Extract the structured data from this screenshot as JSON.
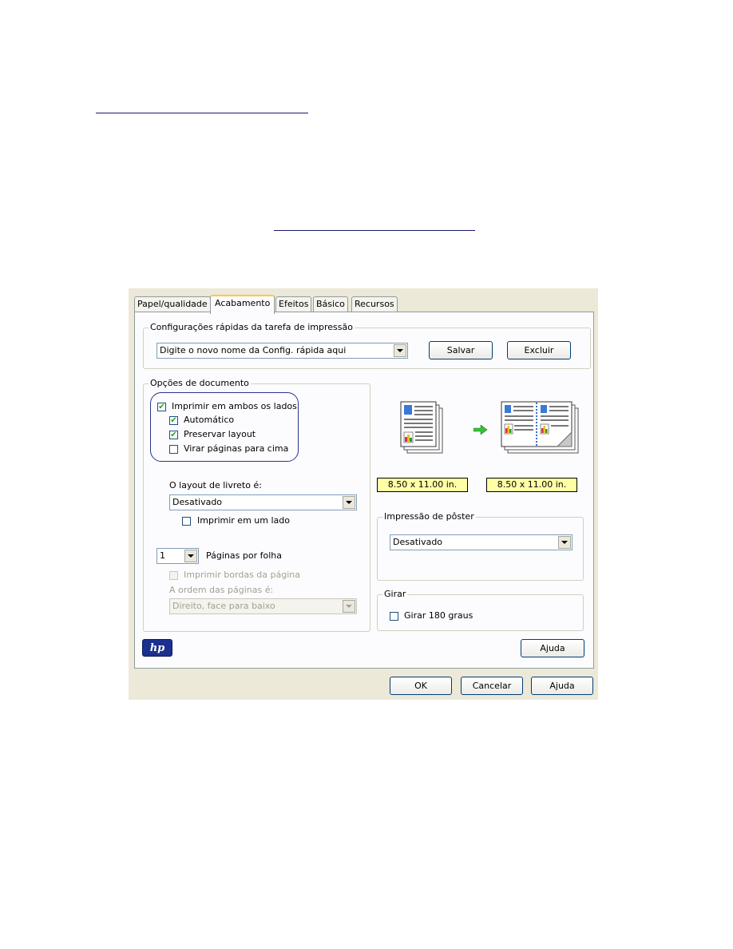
{
  "dialog": {
    "tabs": [
      "Papel/qualidade",
      "Acabamento",
      "Efeitos",
      "Básico",
      "Recursos"
    ],
    "active_tab": "Acabamento",
    "quick_settings": {
      "group_label": "Configurações rápidas da tarefa de impressão",
      "combo_value": "Digite o novo nome da Config. rápida aqui",
      "save_label": "Salvar",
      "delete_label": "Excluir"
    },
    "document_options": {
      "group_label": "Opções de documento",
      "print_both_sides": {
        "label": "Imprimir em ambos os lados",
        "checked": true
      },
      "automatic": {
        "label": "Automático",
        "checked": true
      },
      "preserve_layout": {
        "label": "Preservar layout",
        "checked": true
      },
      "flip_pages_up": {
        "label": "Virar páginas para cima",
        "checked": false
      },
      "booklet_label": "O layout de livreto é:",
      "booklet_value": "Desativado",
      "print_one_side": {
        "label": "Imprimir em um lado",
        "checked": false
      },
      "pages_per_sheet_value": "1",
      "pages_per_sheet_label": "Páginas por folha",
      "print_borders": {
        "label": "Imprimir bordas da página",
        "checked": false
      },
      "page_order_label": "A ordem das páginas é:",
      "page_order_value": "Direito, face para baixo"
    },
    "preview": {
      "left_size": "8.50 x 11.00 in.",
      "right_size": "8.50 x 11.00 in."
    },
    "poster": {
      "group_label": "Impressão de pôster",
      "value": "Desativado"
    },
    "rotate": {
      "group_label": "Girar",
      "label": "Girar 180 graus",
      "checked": false
    },
    "help_inner_label": "Ajuda",
    "footer": {
      "ok": "OK",
      "cancel": "Cancelar",
      "help": "Ajuda"
    },
    "logo_text": "hp"
  },
  "colors": {
    "dialog_bg": "#ece9d8",
    "panel_bg": "#fcfcfe",
    "size_box": "#ffffa6",
    "highlight": "#27358f",
    "hp_blue": "#1b2f8f"
  }
}
